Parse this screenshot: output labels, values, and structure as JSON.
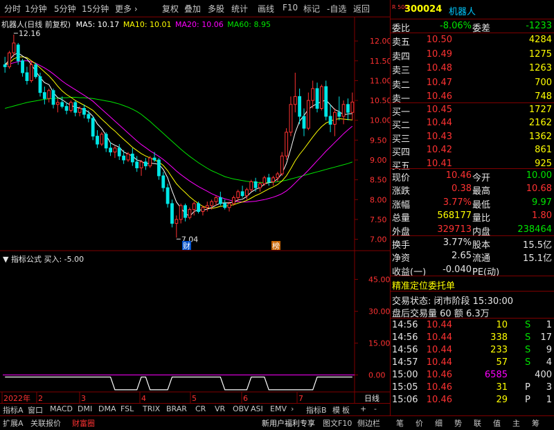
{
  "toolbar": {
    "items": [
      "分时",
      "1分钟",
      "5分钟",
      "15分钟",
      "更多 ›",
      "复权",
      "叠加",
      "多股",
      "统计",
      "画线",
      "F10",
      "标记",
      "-自选",
      "返回"
    ]
  },
  "header": {
    "stock_name": "机器人",
    "mode": "(日线 前复权)",
    "ma5": "MA5: 10.17",
    "ma10": "MA10: 10.01",
    "ma20": "MA20: 10.06",
    "ma60": "MA60: 8.95"
  },
  "price_axis": [
    "12.00",
    "11.50",
    "11.00",
    "10.50",
    "10.00",
    "9.50",
    "9.00",
    "8.50",
    "8.00",
    "7.50",
    "7.00"
  ],
  "indicator_axis": [
    "45.00",
    "30.00",
    "15.00",
    "0.00"
  ],
  "annotations": {
    "high": "12.16",
    "low": "7.04",
    "badge_cai": "财",
    "badge_bang": "榜"
  },
  "indicator": {
    "title": "指标公式",
    "value": "买入: -5.00"
  },
  "date_axis": [
    "2022年",
    "2",
    "3",
    "4",
    "5",
    "6",
    "7"
  ],
  "date_axis_right": "日线",
  "bottom_tabs": [
    "指标A",
    "窗口",
    "MACD",
    "DMI",
    "DMA",
    "FSL",
    "TRIX",
    "BRAR",
    "CR",
    "VR",
    "OBV",
    "ASI",
    "EMV",
    "›",
    "指标B",
    "模",
    "板",
    "+",
    "-"
  ],
  "status_bar": {
    "left": [
      "扩展A",
      "关联报价",
      "财富圈"
    ],
    "right": [
      "新用户福利专享",
      "图文F10",
      "侧边栏",
      "笔",
      "价",
      "细",
      "势",
      "联",
      "值",
      "主",
      "筹"
    ]
  },
  "quote": {
    "code": "300024",
    "name": "机器人",
    "badge": "R 500",
    "weibi_label": "委比",
    "weibi_value": "-8.06%",
    "weicha_label": "委差",
    "weicha_value": "-1233",
    "sell": [
      {
        "label": "卖五",
        "price": "10.50",
        "vol": "4284"
      },
      {
        "label": "卖四",
        "price": "10.49",
        "vol": "1275"
      },
      {
        "label": "卖三",
        "price": "10.48",
        "vol": "1263"
      },
      {
        "label": "卖二",
        "price": "10.47",
        "vol": "700"
      },
      {
        "label": "卖一",
        "price": "10.46",
        "vol": "748"
      }
    ],
    "buy": [
      {
        "label": "买一",
        "price": "10.45",
        "vol": "1727"
      },
      {
        "label": "买二",
        "price": "10.44",
        "vol": "2162"
      },
      {
        "label": "买三",
        "price": "10.43",
        "vol": "1362"
      },
      {
        "label": "买四",
        "price": "10.42",
        "vol": "861"
      },
      {
        "label": "买五",
        "price": "10.41",
        "vol": "925"
      }
    ],
    "stats": [
      {
        "l1": "现价",
        "v1": "10.46",
        "c1": "red",
        "l2": "今开",
        "v2": "10.00",
        "c2": "green"
      },
      {
        "l1": "涨跌",
        "v1": "0.38",
        "c1": "red",
        "l2": "最高",
        "v2": "10.68",
        "c2": "red"
      },
      {
        "l1": "涨幅",
        "v1": "3.77%",
        "c1": "red",
        "l2": "最低",
        "v2": "9.97",
        "c2": "green"
      },
      {
        "l1": "总量",
        "v1": "568177",
        "c1": "yellow",
        "l2": "量比",
        "v2": "1.80",
        "c2": "red"
      },
      {
        "l1": "外盘",
        "v1": "329713",
        "c1": "red",
        "l2": "内盘",
        "v2": "238464",
        "c2": "green"
      }
    ],
    "stats2": [
      {
        "l1": "换手",
        "v1": "3.77%",
        "l2": "股本",
        "v2": "15.5亿"
      },
      {
        "l1": "净资",
        "v1": "2.65",
        "l2": "流通",
        "v2": "15.1亿"
      },
      {
        "l1": "收益(一)",
        "v1": "-0.040",
        "l2": "PE(动)",
        "v2": ""
      }
    ],
    "precise_title": "精准定位委托单",
    "trade_status": "交易状态: 闭市阶段 15:30:00",
    "after_hours": "盘后交易量 60 额 6.3万",
    "ticks": [
      {
        "t": "14:56",
        "p": "10.44",
        "v": "10",
        "bs": "S",
        "n": "1",
        "vc": "yellow",
        "bc": "green"
      },
      {
        "t": "14:56",
        "p": "10.44",
        "v": "338",
        "bs": "S",
        "n": "17",
        "vc": "yellow",
        "bc": "green"
      },
      {
        "t": "14:56",
        "p": "10.44",
        "v": "233",
        "bs": "S",
        "n": "9",
        "vc": "yellow",
        "bc": "green"
      },
      {
        "t": "14:57",
        "p": "10.44",
        "v": "57",
        "bs": "S",
        "n": "4",
        "vc": "yellow",
        "bc": "green"
      },
      {
        "t": "15:00",
        "p": "10.46",
        "v": "6585",
        "bs": "",
        "n": "400",
        "vc": "magenta",
        "bc": "gray"
      },
      {
        "t": "15:05",
        "p": "10.46",
        "v": "31",
        "bs": "P",
        "n": "3",
        "vc": "yellow",
        "bc": "white"
      },
      {
        "t": "15:06",
        "p": "10.46",
        "v": "29",
        "bs": "P",
        "n": "1",
        "vc": "yellow",
        "bc": "white"
      }
    ]
  },
  "colors": {
    "up": "#ff3232",
    "down": "#00e6e6",
    "ma5": "#ffffff",
    "ma10": "#ffff00",
    "ma20": "#ff00ff",
    "ma60": "#00e600",
    "frame": "#800000"
  },
  "chart_data": {
    "type": "candlestick",
    "ylim": [
      6.8,
      12.3
    ],
    "ohlc": [
      [
        11.4,
        11.6,
        11.2,
        11.35
      ],
      [
        11.35,
        11.75,
        11.3,
        11.7
      ],
      [
        11.7,
        12.16,
        11.6,
        11.95
      ],
      [
        11.9,
        11.95,
        11.4,
        11.5
      ],
      [
        11.5,
        11.55,
        11.1,
        11.2
      ],
      [
        11.2,
        11.35,
        10.9,
        11.0
      ],
      [
        11.0,
        11.5,
        10.95,
        11.4
      ],
      [
        11.4,
        11.45,
        11.05,
        11.1
      ],
      [
        11.1,
        11.2,
        10.6,
        10.7
      ],
      [
        10.7,
        10.85,
        10.4,
        10.55
      ],
      [
        10.55,
        10.8,
        10.45,
        10.75
      ],
      [
        10.75,
        10.8,
        10.3,
        10.4
      ],
      [
        10.4,
        10.55,
        10.2,
        10.45
      ],
      [
        10.45,
        10.6,
        10.3,
        10.35
      ],
      [
        10.35,
        10.45,
        10.15,
        10.25
      ],
      [
        10.25,
        10.5,
        10.2,
        10.45
      ],
      [
        10.45,
        10.5,
        10.1,
        10.2
      ],
      [
        10.2,
        10.35,
        10.1,
        10.3
      ],
      [
        10.3,
        10.4,
        10.05,
        10.15
      ],
      [
        10.15,
        10.25,
        9.95,
        10.05
      ],
      [
        10.05,
        10.1,
        9.5,
        9.6
      ],
      [
        9.6,
        9.75,
        9.3,
        9.4
      ],
      [
        9.4,
        9.7,
        9.35,
        9.65
      ],
      [
        9.65,
        9.7,
        9.2,
        9.3
      ],
      [
        9.3,
        9.45,
        9.1,
        9.2
      ],
      [
        9.2,
        9.35,
        9.05,
        9.3
      ],
      [
        9.3,
        9.4,
        9.0,
        9.1
      ],
      [
        9.1,
        9.25,
        8.9,
        9.0
      ],
      [
        9.0,
        9.2,
        8.95,
        9.15
      ],
      [
        9.15,
        9.3,
        8.85,
        8.95
      ],
      [
        8.95,
        9.1,
        8.7,
        8.8
      ],
      [
        8.8,
        9.0,
        8.6,
        8.95
      ],
      [
        8.95,
        9.05,
        8.75,
        8.85
      ],
      [
        8.85,
        9.1,
        8.8,
        9.05
      ],
      [
        9.05,
        9.2,
        8.95,
        9.0
      ],
      [
        9.0,
        9.05,
        8.5,
        8.6
      ],
      [
        8.6,
        8.7,
        8.2,
        8.3
      ],
      [
        8.3,
        8.4,
        7.8,
        7.9
      ],
      [
        7.9,
        8.0,
        7.3,
        7.4
      ],
      [
        7.4,
        7.6,
        7.04,
        7.5
      ],
      [
        7.5,
        7.9,
        7.4,
        7.85
      ],
      [
        7.85,
        7.9,
        7.45,
        7.55
      ],
      [
        7.55,
        7.8,
        7.5,
        7.75
      ],
      [
        7.75,
        7.95,
        7.6,
        7.9
      ],
      [
        7.9,
        7.95,
        7.65,
        7.7
      ],
      [
        7.7,
        7.85,
        7.6,
        7.8
      ],
      [
        7.8,
        7.95,
        7.7,
        7.85
      ],
      [
        7.85,
        8.0,
        7.75,
        7.95
      ],
      [
        7.95,
        8.1,
        7.85,
        8.05
      ],
      [
        8.05,
        8.2,
        7.85,
        7.9
      ],
      [
        7.9,
        8.0,
        7.75,
        7.8
      ],
      [
        7.8,
        7.95,
        7.7,
        7.9
      ],
      [
        7.9,
        8.1,
        7.85,
        8.05
      ],
      [
        8.05,
        8.25,
        7.95,
        8.2
      ],
      [
        8.2,
        8.35,
        8.05,
        8.1
      ],
      [
        8.1,
        8.3,
        8.0,
        8.25
      ],
      [
        8.25,
        8.5,
        8.2,
        8.45
      ],
      [
        8.45,
        8.55,
        8.2,
        8.3
      ],
      [
        8.3,
        8.45,
        8.2,
        8.4
      ],
      [
        8.4,
        8.6,
        8.35,
        8.55
      ],
      [
        8.55,
        8.65,
        8.35,
        8.45
      ],
      [
        8.45,
        8.6,
        8.35,
        8.55
      ],
      [
        8.55,
        8.7,
        8.45,
        8.65
      ],
      [
        8.65,
        9.2,
        8.6,
        9.1
      ],
      [
        9.1,
        9.8,
        9.0,
        9.7
      ],
      [
        9.7,
        10.6,
        9.6,
        10.4
      ],
      [
        10.4,
        11.2,
        10.2,
        10.6
      ],
      [
        10.6,
        10.8,
        9.9,
        10.1
      ],
      [
        10.1,
        10.3,
        9.6,
        9.8
      ],
      [
        9.8,
        10.7,
        9.75,
        10.5
      ],
      [
        10.5,
        11.0,
        10.3,
        10.8
      ],
      [
        10.8,
        10.95,
        10.2,
        10.3
      ],
      [
        10.3,
        10.9,
        10.25,
        10.85
      ],
      [
        10.85,
        11.0,
        10.0,
        10.1
      ],
      [
        10.1,
        10.4,
        9.7,
        9.9
      ],
      [
        9.9,
        10.3,
        9.6,
        10.2
      ],
      [
        10.2,
        10.6,
        10.0,
        10.1
      ],
      [
        10.1,
        10.5,
        9.9,
        10.4
      ],
      [
        10.4,
        10.55,
        10.0,
        10.2
      ],
      [
        10.2,
        10.7,
        10.0,
        10.46
      ]
    ],
    "ma5": [
      11.4,
      11.52,
      11.65,
      11.7,
      11.62,
      11.55,
      11.4,
      11.24,
      11.08,
      10.95,
      10.9,
      10.7,
      10.57,
      10.52,
      10.44,
      10.38,
      10.33,
      10.31,
      10.27,
      10.21,
      10.1,
      9.91,
      9.79,
      9.62,
      9.43,
      9.37,
      9.32,
      9.2,
      9.15,
      9.1,
      9.0,
      8.97,
      8.9,
      8.92,
      8.91,
      8.89,
      8.76,
      8.55,
      8.22,
      7.94,
      7.79,
      7.65,
      7.58,
      7.7,
      7.75,
      7.73,
      7.76,
      7.8,
      7.86,
      7.91,
      7.92,
      7.92,
      7.94,
      7.99,
      8.01,
      8.08,
      8.19,
      8.26,
      8.3,
      8.39,
      8.43,
      8.45,
      8.52,
      8.66,
      8.91,
      9.28,
      9.69,
      9.98,
      10.12,
      10.28,
      10.36,
      10.42,
      10.47,
      10.51,
      10.39,
      10.27,
      10.22,
      10.14,
      10.16,
      10.17
    ],
    "ma10": [
      11.4,
      11.45,
      11.55,
      11.6,
      11.6,
      11.58,
      11.5,
      11.42,
      11.32,
      11.22,
      11.12,
      11.0,
      10.86,
      10.74,
      10.65,
      10.58,
      10.5,
      10.44,
      10.38,
      10.32,
      10.25,
      10.14,
      10.03,
      9.93,
      9.82,
      9.73,
      9.62,
      9.52,
      9.42,
      9.32,
      9.24,
      9.16,
      9.1,
      9.05,
      9.0,
      8.95,
      8.86,
      8.73,
      8.56,
      8.4,
      8.28,
      8.18,
      8.07,
      7.98,
      7.9,
      7.83,
      7.79,
      7.78,
      7.8,
      7.83,
      7.84,
      7.85,
      7.87,
      7.91,
      7.94,
      7.98,
      8.04,
      8.1,
      8.15,
      8.21,
      8.27,
      8.32,
      8.38,
      8.47,
      8.6,
      8.78,
      8.98,
      9.14,
      9.28,
      9.43,
      9.58,
      9.72,
      9.84,
      9.93,
      9.98,
      10.02,
      10.04,
      10.03,
      10.02,
      10.01
    ],
    "ma20": [
      11.4,
      11.42,
      11.45,
      11.48,
      11.5,
      11.5,
      11.48,
      11.44,
      11.38,
      11.32,
      11.25,
      11.17,
      11.08,
      10.99,
      10.91,
      10.84,
      10.77,
      10.7,
      10.63,
      10.56,
      10.48,
      10.38,
      10.28,
      10.18,
      10.08,
      9.98,
      9.88,
      9.78,
      9.68,
      9.58,
      9.48,
      9.39,
      9.31,
      9.23,
      9.16,
      9.09,
      9.01,
      8.92,
      8.82,
      8.72,
      8.63,
      8.55,
      8.47,
      8.4,
      8.33,
      8.27,
      8.21,
      8.15,
      8.1,
      8.06,
      8.02,
      7.99,
      7.96,
      7.95,
      7.94,
      7.94,
      7.95,
      7.96,
      7.98,
      8.0,
      8.03,
      8.06,
      8.1,
      8.15,
      8.22,
      8.31,
      8.42,
      8.53,
      8.63,
      8.74,
      8.86,
      8.98,
      9.1,
      9.22,
      9.33,
      9.44,
      9.55,
      9.66,
      9.76,
      9.85
    ],
    "ma60": [
      10.3,
      10.33,
      10.36,
      10.39,
      10.42,
      10.45,
      10.47,
      10.49,
      10.51,
      10.53,
      10.54,
      10.55,
      10.56,
      10.57,
      10.57,
      10.58,
      10.58,
      10.57,
      10.57,
      10.56,
      10.55,
      10.53,
      10.51,
      10.49,
      10.47,
      10.44,
      10.41,
      10.37,
      10.33,
      10.28,
      10.22,
      10.15,
      10.06,
      9.97,
      9.87,
      9.77,
      9.67,
      9.57,
      9.47,
      9.37,
      9.27,
      9.18,
      9.09,
      9.01,
      8.93,
      8.86,
      8.79,
      8.73,
      8.68,
      8.63,
      8.58,
      8.55,
      8.52,
      8.5,
      8.48,
      8.46,
      8.45,
      8.44,
      8.43,
      8.43,
      8.43,
      8.44,
      8.45,
      8.47,
      8.49,
      8.52,
      8.55,
      8.58,
      8.61,
      8.64,
      8.67,
      8.7,
      8.73,
      8.76,
      8.79,
      8.82,
      8.85,
      8.88,
      8.91,
      8.95
    ],
    "indicator_bars": [
      0,
      0,
      0,
      0,
      0,
      0,
      0,
      0,
      0,
      0,
      0,
      0,
      0,
      0,
      0,
      0,
      0,
      0,
      0,
      0,
      0,
      0,
      0,
      0,
      0,
      0,
      0,
      0,
      0,
      0,
      0,
      0,
      0,
      0,
      0,
      0,
      0,
      0,
      0,
      0,
      0,
      0,
      0,
      0,
      0,
      0,
      0,
      0,
      0,
      0,
      0,
      0,
      0,
      0,
      0,
      0,
      0,
      0,
      0,
      0,
      0,
      0,
      0,
      0,
      0,
      0,
      0,
      0,
      0,
      0,
      0,
      0,
      0,
      0,
      0,
      0,
      0,
      0,
      0,
      0
    ],
    "indicator_ylim": [
      -8,
      52
    ]
  }
}
